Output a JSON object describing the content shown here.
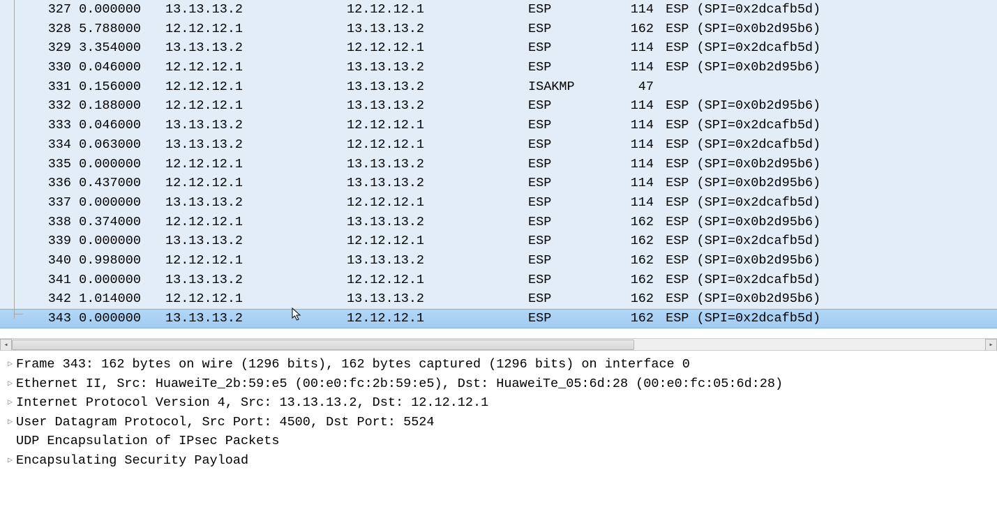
{
  "packets": [
    {
      "no": "327",
      "time": "0.000000",
      "src": "13.13.13.2",
      "dst": "12.12.12.1",
      "proto": "ESP",
      "len": "114",
      "info": "ESP (SPI=0x2dcafb5d)"
    },
    {
      "no": "328",
      "time": "5.788000",
      "src": "12.12.12.1",
      "dst": "13.13.13.2",
      "proto": "ESP",
      "len": "162",
      "info": "ESP (SPI=0x0b2d95b6)"
    },
    {
      "no": "329",
      "time": "3.354000",
      "src": "13.13.13.2",
      "dst": "12.12.12.1",
      "proto": "ESP",
      "len": "114",
      "info": "ESP (SPI=0x2dcafb5d)"
    },
    {
      "no": "330",
      "time": "0.046000",
      "src": "12.12.12.1",
      "dst": "13.13.13.2",
      "proto": "ESP",
      "len": "114",
      "info": "ESP (SPI=0x0b2d95b6)"
    },
    {
      "no": "331",
      "time": "0.156000",
      "src": "12.12.12.1",
      "dst": "13.13.13.2",
      "proto": "ISAKMP",
      "len": "47",
      "info": ""
    },
    {
      "no": "332",
      "time": "0.188000",
      "src": "12.12.12.1",
      "dst": "13.13.13.2",
      "proto": "ESP",
      "len": "114",
      "info": "ESP (SPI=0x0b2d95b6)"
    },
    {
      "no": "333",
      "time": "0.046000",
      "src": "13.13.13.2",
      "dst": "12.12.12.1",
      "proto": "ESP",
      "len": "114",
      "info": "ESP (SPI=0x2dcafb5d)"
    },
    {
      "no": "334",
      "time": "0.063000",
      "src": "13.13.13.2",
      "dst": "12.12.12.1",
      "proto": "ESP",
      "len": "114",
      "info": "ESP (SPI=0x2dcafb5d)"
    },
    {
      "no": "335",
      "time": "0.000000",
      "src": "12.12.12.1",
      "dst": "13.13.13.2",
      "proto": "ESP",
      "len": "114",
      "info": "ESP (SPI=0x0b2d95b6)"
    },
    {
      "no": "336",
      "time": "0.437000",
      "src": "12.12.12.1",
      "dst": "13.13.13.2",
      "proto": "ESP",
      "len": "114",
      "info": "ESP (SPI=0x0b2d95b6)"
    },
    {
      "no": "337",
      "time": "0.000000",
      "src": "13.13.13.2",
      "dst": "12.12.12.1",
      "proto": "ESP",
      "len": "114",
      "info": "ESP (SPI=0x2dcafb5d)"
    },
    {
      "no": "338",
      "time": "0.374000",
      "src": "12.12.12.1",
      "dst": "13.13.13.2",
      "proto": "ESP",
      "len": "162",
      "info": "ESP (SPI=0x0b2d95b6)"
    },
    {
      "no": "339",
      "time": "0.000000",
      "src": "13.13.13.2",
      "dst": "12.12.12.1",
      "proto": "ESP",
      "len": "162",
      "info": "ESP (SPI=0x2dcafb5d)"
    },
    {
      "no": "340",
      "time": "0.998000",
      "src": "12.12.12.1",
      "dst": "13.13.13.2",
      "proto": "ESP",
      "len": "162",
      "info": "ESP (SPI=0x0b2d95b6)"
    },
    {
      "no": "341",
      "time": "0.000000",
      "src": "13.13.13.2",
      "dst": "12.12.12.1",
      "proto": "ESP",
      "len": "162",
      "info": "ESP (SPI=0x2dcafb5d)"
    },
    {
      "no": "342",
      "time": "1.014000",
      "src": "12.12.12.1",
      "dst": "13.13.13.2",
      "proto": "ESP",
      "len": "162",
      "info": "ESP (SPI=0x0b2d95b6)"
    },
    {
      "no": "343",
      "time": "0.000000",
      "src": "13.13.13.2",
      "dst": "12.12.12.1",
      "proto": "ESP",
      "len": "162",
      "info": "ESP (SPI=0x2dcafb5d)",
      "selected": true,
      "last": true
    }
  ],
  "details": [
    {
      "expandable": true,
      "text": "Frame 343: 162 bytes on wire (1296 bits), 162 bytes captured (1296 bits) on interface 0"
    },
    {
      "expandable": true,
      "text": "Ethernet II, Src: HuaweiTe_2b:59:e5 (00:e0:fc:2b:59:e5), Dst: HuaweiTe_05:6d:28 (00:e0:fc:05:6d:28)"
    },
    {
      "expandable": true,
      "text": "Internet Protocol Version 4, Src: 13.13.13.2, Dst: 12.12.12.1"
    },
    {
      "expandable": true,
      "text": "User Datagram Protocol, Src Port: 4500, Dst Port: 5524"
    },
    {
      "expandable": false,
      "text": "UDP Encapsulation of IPsec Packets"
    },
    {
      "expandable": true,
      "text": "Encapsulating Security Payload"
    }
  ]
}
